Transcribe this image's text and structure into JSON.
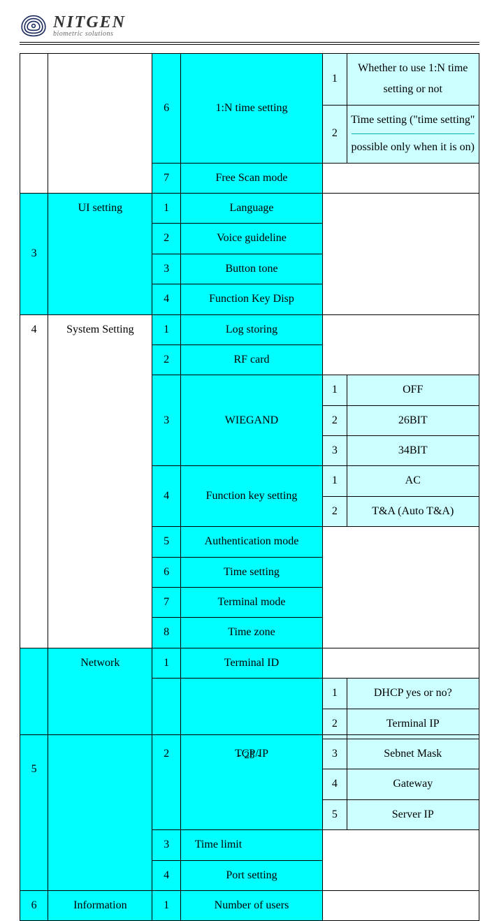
{
  "logo": {
    "name": "NITGEN",
    "tagline": "biometric solutions"
  },
  "page_number": "- 25 -",
  "sections": {
    "pre": {
      "r6": {
        "num": "6",
        "label": "1:N time setting",
        "subs": [
          {
            "n": "1",
            "t": "Whether to use 1:N time setting or not"
          },
          {
            "n": "2",
            "t1": "Time setting (\"time setting\"",
            "t2": "possible only when it is on)"
          }
        ]
      },
      "r7": {
        "num": "7",
        "label": "Free Scan mode"
      }
    },
    "ui": {
      "num": "3",
      "name": "UI setting",
      "rows": [
        {
          "n": "1",
          "t": "Language"
        },
        {
          "n": "2",
          "t": "Voice guideline"
        },
        {
          "n": "3",
          "t": "Button tone"
        },
        {
          "n": "4",
          "t": "Function Key Disp"
        }
      ]
    },
    "sys": {
      "num": "4",
      "name": "System Setting",
      "rows": {
        "r1": {
          "n": "1",
          "t": "Log storing"
        },
        "r2": {
          "n": "2",
          "t": "RF card"
        },
        "r3": {
          "n": "3",
          "t": "WIEGAND",
          "subs": [
            {
              "n": "1",
              "t": "OFF"
            },
            {
              "n": "2",
              "t": "26BIT"
            },
            {
              "n": "3",
              "t": "34BIT"
            }
          ]
        },
        "r4": {
          "n": "4",
          "t": "Function key setting",
          "subs": [
            {
              "n": "1",
              "t": "AC"
            },
            {
              "n": "2",
              "t": "T&A (Auto T&A)"
            }
          ]
        },
        "r5": {
          "n": "5",
          "t": "Authentication mode"
        },
        "r6": {
          "n": "6",
          "t": "Time setting"
        },
        "r7": {
          "n": "7",
          "t": "Terminal mode"
        },
        "r8": {
          "n": "8",
          "t": "Time zone"
        }
      }
    },
    "net": {
      "num": "5",
      "name": "Network",
      "rows": {
        "r1": {
          "n": "1",
          "t": "Terminal ID"
        },
        "r2": {
          "n": "2",
          "t": "TCP/IP",
          "subs": [
            {
              "n": "1",
              "t": "DHCP yes or no?"
            },
            {
              "n": "2",
              "t": "Terminal IP"
            },
            {
              "n": "3",
              "t": "Sebnet Mask"
            },
            {
              "n": "4",
              "t": "Gateway"
            },
            {
              "n": "5",
              "t": "Server IP"
            }
          ]
        },
        "r3": {
          "n": "3",
          "t": "Time limit"
        },
        "r4": {
          "n": "4",
          "t": "Port setting"
        }
      }
    },
    "info": {
      "num": "6",
      "name": "Information",
      "rows": [
        {
          "n": "1",
          "t": "Number of users"
        }
      ]
    }
  }
}
